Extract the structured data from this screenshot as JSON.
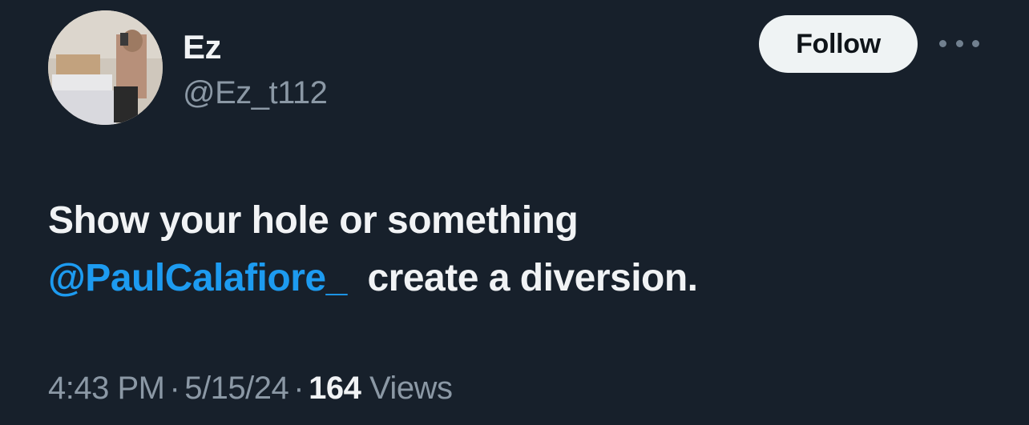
{
  "user": {
    "display_name": "Ez",
    "handle": "@Ez_t112",
    "avatar_icon": "user-avatar-photo"
  },
  "actions": {
    "follow_label": "Follow",
    "more_icon": "more-horizontal-icon"
  },
  "tweet": {
    "line1": "Show your hole or something",
    "mention": "@PaulCalafiore_",
    "line2_rest": "create a diversion."
  },
  "meta": {
    "time": "4:43 PM",
    "separator": "·",
    "date": "5/15/24",
    "views_count": "164",
    "views_label": "Views"
  },
  "colors": {
    "background": "#17202b",
    "primary_text": "#f1f3f5",
    "secondary_text": "#8b98a5",
    "link": "#1d9bf0",
    "follow_bg": "#eff3f4"
  }
}
